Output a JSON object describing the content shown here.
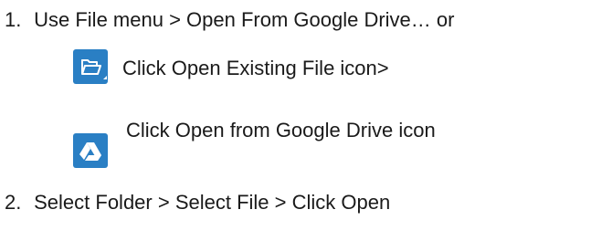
{
  "steps": [
    {
      "number": "1.",
      "text": "Use File menu > Open From Google Drive… or",
      "substeps": [
        {
          "icon": "open-folder-icon",
          "text": "Click Open Existing File icon>"
        },
        {
          "icon": "google-drive-icon",
          "text": "Click Open from Google Drive icon"
        }
      ]
    },
    {
      "number": "2.",
      "text": "Select Folder > Select File > Click Open"
    }
  ],
  "colors": {
    "icon_background": "#2a7fc4",
    "icon_foreground": "#ffffff",
    "text": "#1a1a1a"
  }
}
